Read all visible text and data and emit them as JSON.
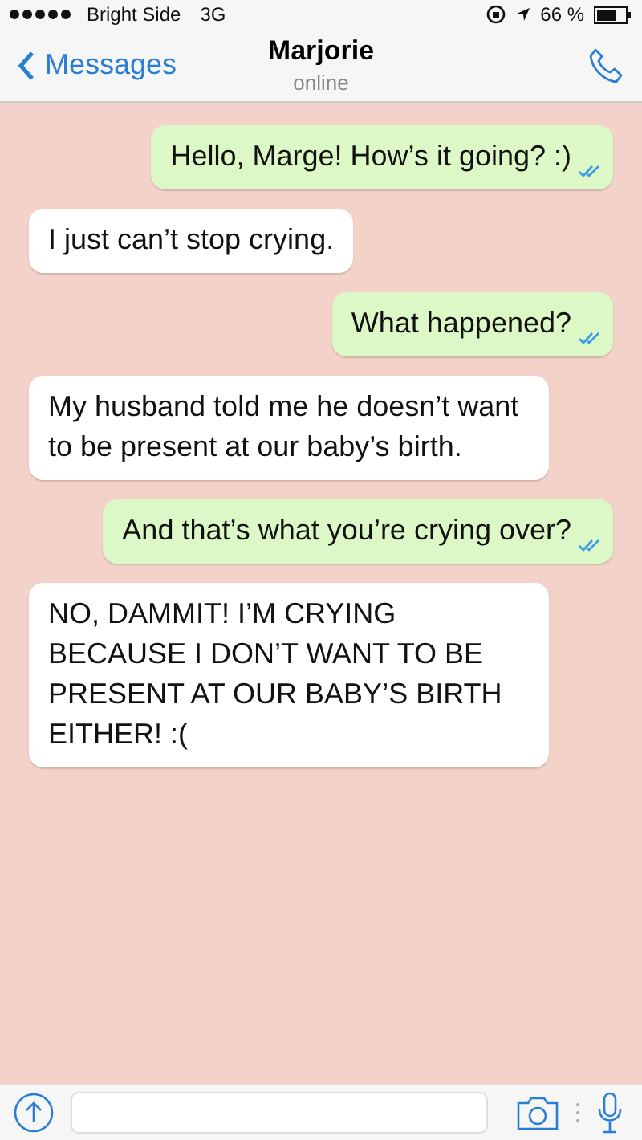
{
  "status_bar": {
    "carrier": "Bright Side",
    "network": "3G",
    "battery": "66 %"
  },
  "nav": {
    "back": "Messages",
    "title": "Marjorie",
    "subtitle": "online"
  },
  "messages": [
    {
      "kind": "outgoing",
      "text": "Hello, Marge! How’s it going? :)",
      "read": true
    },
    {
      "kind": "incoming",
      "text": "I just can’t stop crying."
    },
    {
      "kind": "outgoing",
      "text": "What happened?",
      "read": true
    },
    {
      "kind": "incoming",
      "text": "My husband told me he doesn’t want to be present at our baby’s birth."
    },
    {
      "kind": "outgoing",
      "text": "And that’s what you’re crying over?",
      "read": true
    },
    {
      "kind": "incoming",
      "text": "NO, DAMMIT! I’M CRYING BECAUSE I DON’T WANT TO BE PRESENT AT OUR BABY’S BIRTH EITHER! :("
    }
  ]
}
